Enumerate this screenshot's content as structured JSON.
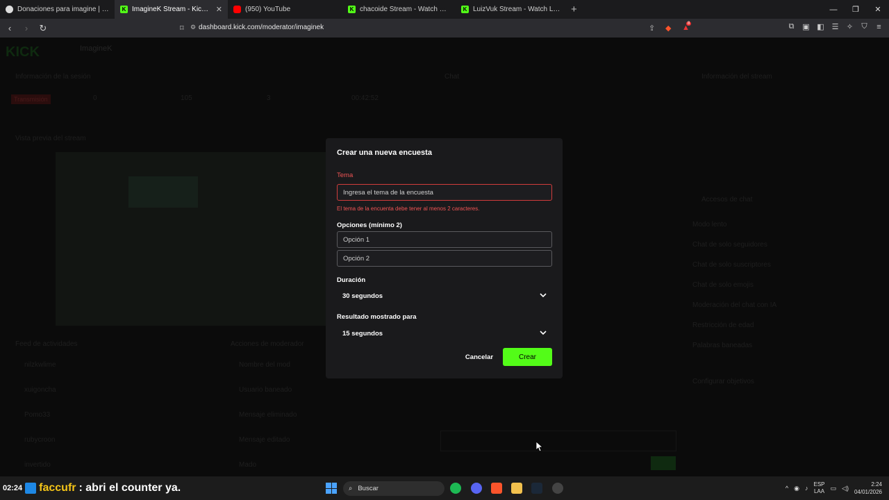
{
  "browser": {
    "tabs": [
      {
        "title": "Donaciones para imagine | Ceneka",
        "favicon": "globe-icon",
        "active": false
      },
      {
        "title": "ImagineK Stream - Kick Dashboard",
        "favicon": "kick-icon",
        "active": true
      },
      {
        "title": "(950) YouTube",
        "favicon": "youtube-icon",
        "active": false
      },
      {
        "title": "chacoide Stream - Watch Live on Kick",
        "favicon": "kick-icon",
        "active": false
      },
      {
        "title": "LuizVuk Stream - Watch Live on Kick",
        "favicon": "kick-icon",
        "active": false
      }
    ],
    "url": "dashboard.kick.com/moderator/imaginek",
    "badge_count": "8"
  },
  "background": {
    "logo": "KICK",
    "channel": "ImagineK",
    "panels": {
      "stream_info": "Información de la sesión",
      "live_badge": "Transmisión",
      "chat": "Chat",
      "stream_info_right": "Información del stream",
      "stream_preview": "Vista previa del stream",
      "activity": "Feed de actividades",
      "mod_actions": "Acciones de moderador",
      "mod_settings": "Accesos de chat"
    },
    "stats": [
      "0",
      "105",
      "3",
      "00:42:52"
    ],
    "settings_items": [
      "Modo lento",
      "Chat de solo seguidores",
      "Chat de solo suscriptores",
      "Chat de solo emojis",
      "Moderación del chat con IA",
      "Restricción de edad",
      "Palabras baneadas",
      "Configurar objetivos"
    ],
    "activity_items": [
      "nilzkwlime",
      "xuigoncha",
      "Pomo33",
      "rubycroon",
      "invertido"
    ],
    "mod_items": [
      "Nombre del mod",
      "Usuario baneado",
      "Mensaje eliminado",
      "Mensaje editado",
      "Mado"
    ]
  },
  "modal": {
    "title": "Crear una nueva encuesta",
    "topic_label": "Tema",
    "topic_placeholder": "Ingresa el tema de la encuesta",
    "topic_error": "El tema de la encuenta debe tener al menos 2 caracteres.",
    "options_label": "Opciones (mínimo 2)",
    "option1_placeholder": "Opción 1",
    "option2_placeholder": "Opción 2",
    "duration_label": "Duración",
    "duration_value": "30 segundos",
    "result_label": "Resultado mostrado para",
    "result_value": "15 segundos",
    "cancel_label": "Cancelar",
    "create_label": "Crear",
    "accent_color": "#53fc18",
    "error_color": "#f05454"
  },
  "taskbar": {
    "overlay_time": "02:24",
    "overlay_user": "faccufr",
    "overlay_message": ": abri el counter ya.",
    "search_label": "Buscar",
    "lang_line1": "ESP",
    "lang_line2": "LAA",
    "clock_time": "2:24",
    "clock_date": "04/01/2026"
  }
}
